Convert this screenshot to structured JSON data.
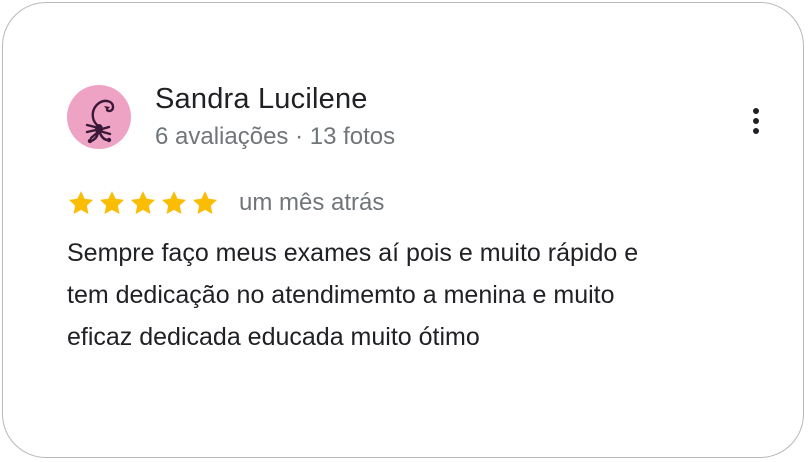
{
  "review": {
    "reviewer": {
      "name": "Sandra Lucilene",
      "meta": "6 avaliações · 13 fotos",
      "avatar_icon": "scorpion-icon",
      "avatar_bg": "#efa3c4"
    },
    "menu_icon": "more-vert-icon",
    "rating": {
      "value": 5,
      "max": 5,
      "star_color": "#fbbc04"
    },
    "date": "um mês atrás",
    "text_lines": [
      "Sempre faço meus exames aí pois e muito rápido e",
      "tem dedicação no atendimemto a menina e muito",
      "eficaz dedicada educada muito ótimo"
    ]
  }
}
